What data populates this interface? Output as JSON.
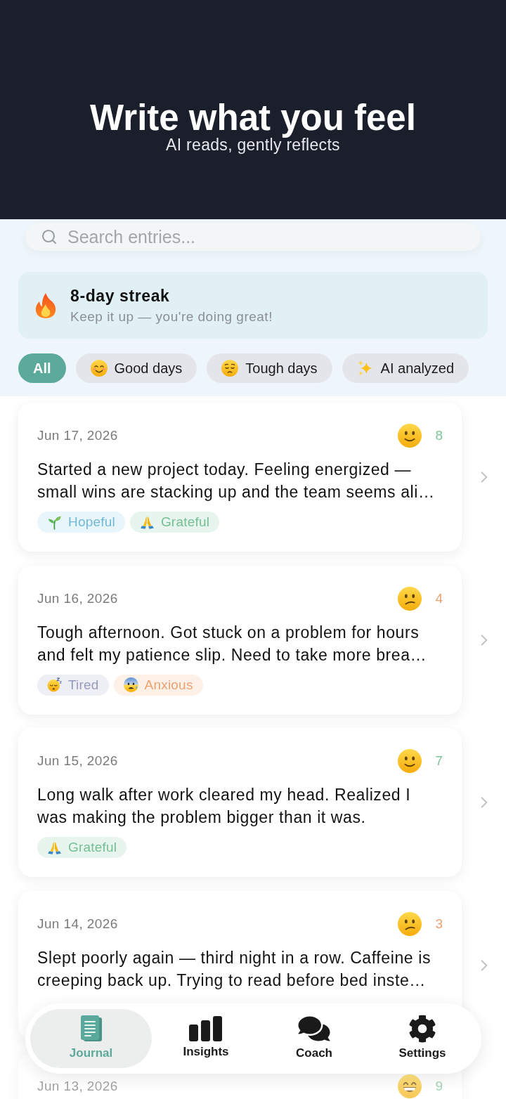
{
  "header": {
    "title": "Write what you feel",
    "subtitle": "AI reads, gently reflects"
  },
  "search": {
    "placeholder": "Search entries..."
  },
  "streak": {
    "title": "8-day streak",
    "message": "Keep it up — you're doing great!"
  },
  "filters": [
    {
      "label": "All",
      "kind": "all",
      "selected": true
    },
    {
      "label": "Good days",
      "kind": "good",
      "selected": false
    },
    {
      "label": "Tough days",
      "kind": "tough",
      "selected": false
    },
    {
      "label": "AI analyzed",
      "kind": "ai",
      "selected": false
    }
  ],
  "entries": [
    {
      "date": "Jun 17, 2026",
      "kind": "good",
      "score": "8",
      "text": "Started a new project today. Feeling energized — small wins are stacking up and the team seems ali…",
      "tags": [
        {
          "label": "Hopeful",
          "kind": "hopeful"
        },
        {
          "label": "Grateful",
          "kind": "grateful"
        }
      ]
    },
    {
      "date": "Jun 16, 2026",
      "kind": "tough",
      "score": "4",
      "text": "Tough afternoon. Got stuck on a problem for hours and felt my patience slip. Need to take more brea…",
      "tags": [
        {
          "label": "Tired",
          "kind": "tired"
        },
        {
          "label": "Anxious",
          "kind": "anxious"
        }
      ]
    },
    {
      "date": "Jun 15, 2026",
      "kind": "good",
      "score": "7",
      "text": "Long walk after work cleared my head. Realized I was making the problem bigger than it was.",
      "tags": [
        {
          "label": "Grateful",
          "kind": "grateful"
        }
      ]
    },
    {
      "date": "Jun 14, 2026",
      "kind": "tough",
      "score": "3",
      "text": "Slept poorly again — third night in a row. Caffeine is creeping back up. Trying to read before bed inste…"
    },
    {
      "date": "Jun 13, 2026",
      "kind": "great",
      "score": "9"
    }
  ],
  "tab_bar": [
    {
      "label": "Journal",
      "kind": "journal",
      "selected": true
    },
    {
      "label": "Insights",
      "kind": "insights",
      "selected": false
    },
    {
      "label": "Coach",
      "kind": "coach",
      "selected": false
    },
    {
      "label": "Settings",
      "kind": "settings",
      "selected": false
    }
  ]
}
